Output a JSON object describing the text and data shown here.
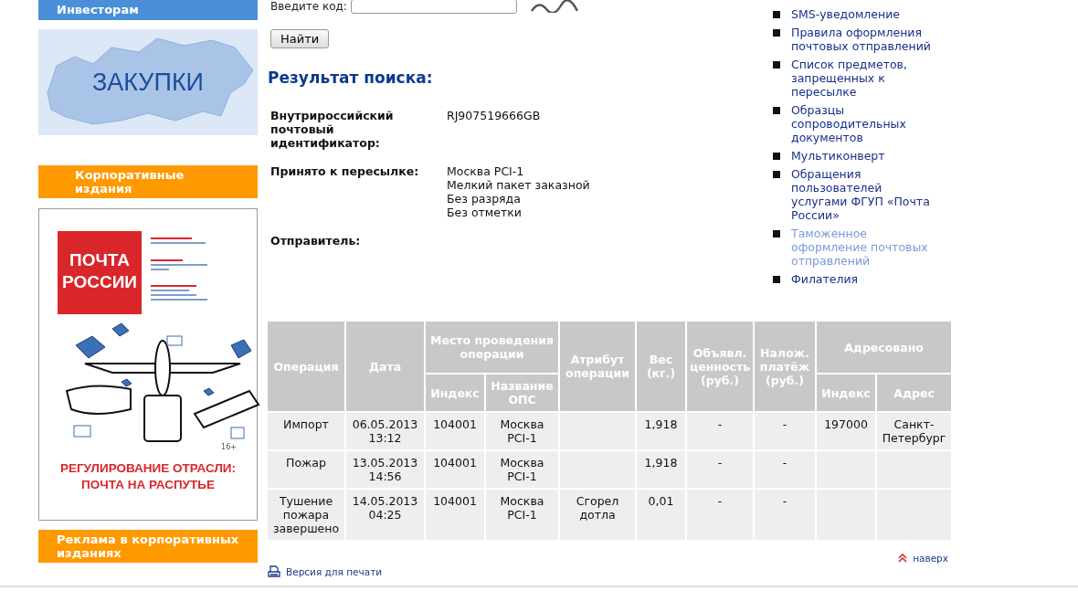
{
  "sidebar": {
    "top_bar": "Инвесторам",
    "banner": "ЗАКУПКИ",
    "section_title": "Корпоративные издания",
    "magazine": {
      "logo": "ПОЧТА РОССИИ",
      "age": "16+",
      "headline": "РЕГУЛИРОВАНИЕ ОТРАСЛИ: ПОЧТА НА РАСПУТЬЕ"
    },
    "bottom_link": "Реклама в корпоративных изданиях"
  },
  "search_form": {
    "code_label": "Введите код:",
    "button": "Найти"
  },
  "result": {
    "title": "Результат поиска:",
    "fields": [
      {
        "label": "Внутрироссийский почтовый идентификатор:",
        "values": [
          "RJ907519666GB"
        ]
      },
      {
        "label": "Принято к пересылке:",
        "values": [
          "Москва PCI-1",
          "Мелкий пакет заказной",
          "Без разряда",
          "Без отметки"
        ]
      },
      {
        "label": "Отправитель:"
      }
    ]
  },
  "links": [
    {
      "label": "SMS-уведомление",
      "visited": false
    },
    {
      "label": "Правила оформления почтовых отправлений",
      "visited": false
    },
    {
      "label": "Список предметов, запрещенных к пересылке",
      "visited": false
    },
    {
      "label": "Образцы сопроводительных документов",
      "visited": false
    },
    {
      "label": "Мультиконверт",
      "visited": false
    },
    {
      "label": "Обращения пользователей услугами ФГУП «Почта России»",
      "visited": false
    },
    {
      "label": "Таможенное оформление почтовых отправлений",
      "visited": true
    },
    {
      "label": "Филателия",
      "visited": false
    }
  ],
  "table": {
    "columns": [
      {
        "label": "Операция"
      },
      {
        "label": "Дата"
      },
      {
        "label": "Место проведения операции",
        "colspan": 2,
        "children": [
          {
            "label": "Индекс"
          },
          {
            "label": "Название ОПС"
          }
        ]
      },
      {
        "label": "Атрибут операции"
      },
      {
        "label": "Вес (кг.)"
      },
      {
        "label": "Объявл. ценность (руб.)"
      },
      {
        "label": "Налож. платёж (руб.)"
      },
      {
        "label": "Адресовано",
        "colspan": 2,
        "children": [
          {
            "label": "Индекс"
          },
          {
            "label": "Адрес"
          }
        ]
      }
    ],
    "rows": [
      [
        "Импорт",
        "06.05.2013 13:12",
        "104001",
        "Москва PCI-1",
        "",
        "1,918",
        "-",
        "-",
        "197000",
        "Санкт-Петербург"
      ],
      [
        "Пожар",
        "13.05.2013 14:56",
        "104001",
        "Москва PCI-1",
        "",
        "1,918",
        "-",
        "-",
        "",
        ""
      ],
      [
        "Тушение пожара завершено",
        "14.05.2013 04:25",
        "104001",
        "Москва PCI-1",
        "Сгорел дотла",
        "0,01",
        "-",
        "-",
        "",
        ""
      ]
    ]
  },
  "footer": {
    "print": "Версия для печати",
    "top": "наверх"
  }
}
